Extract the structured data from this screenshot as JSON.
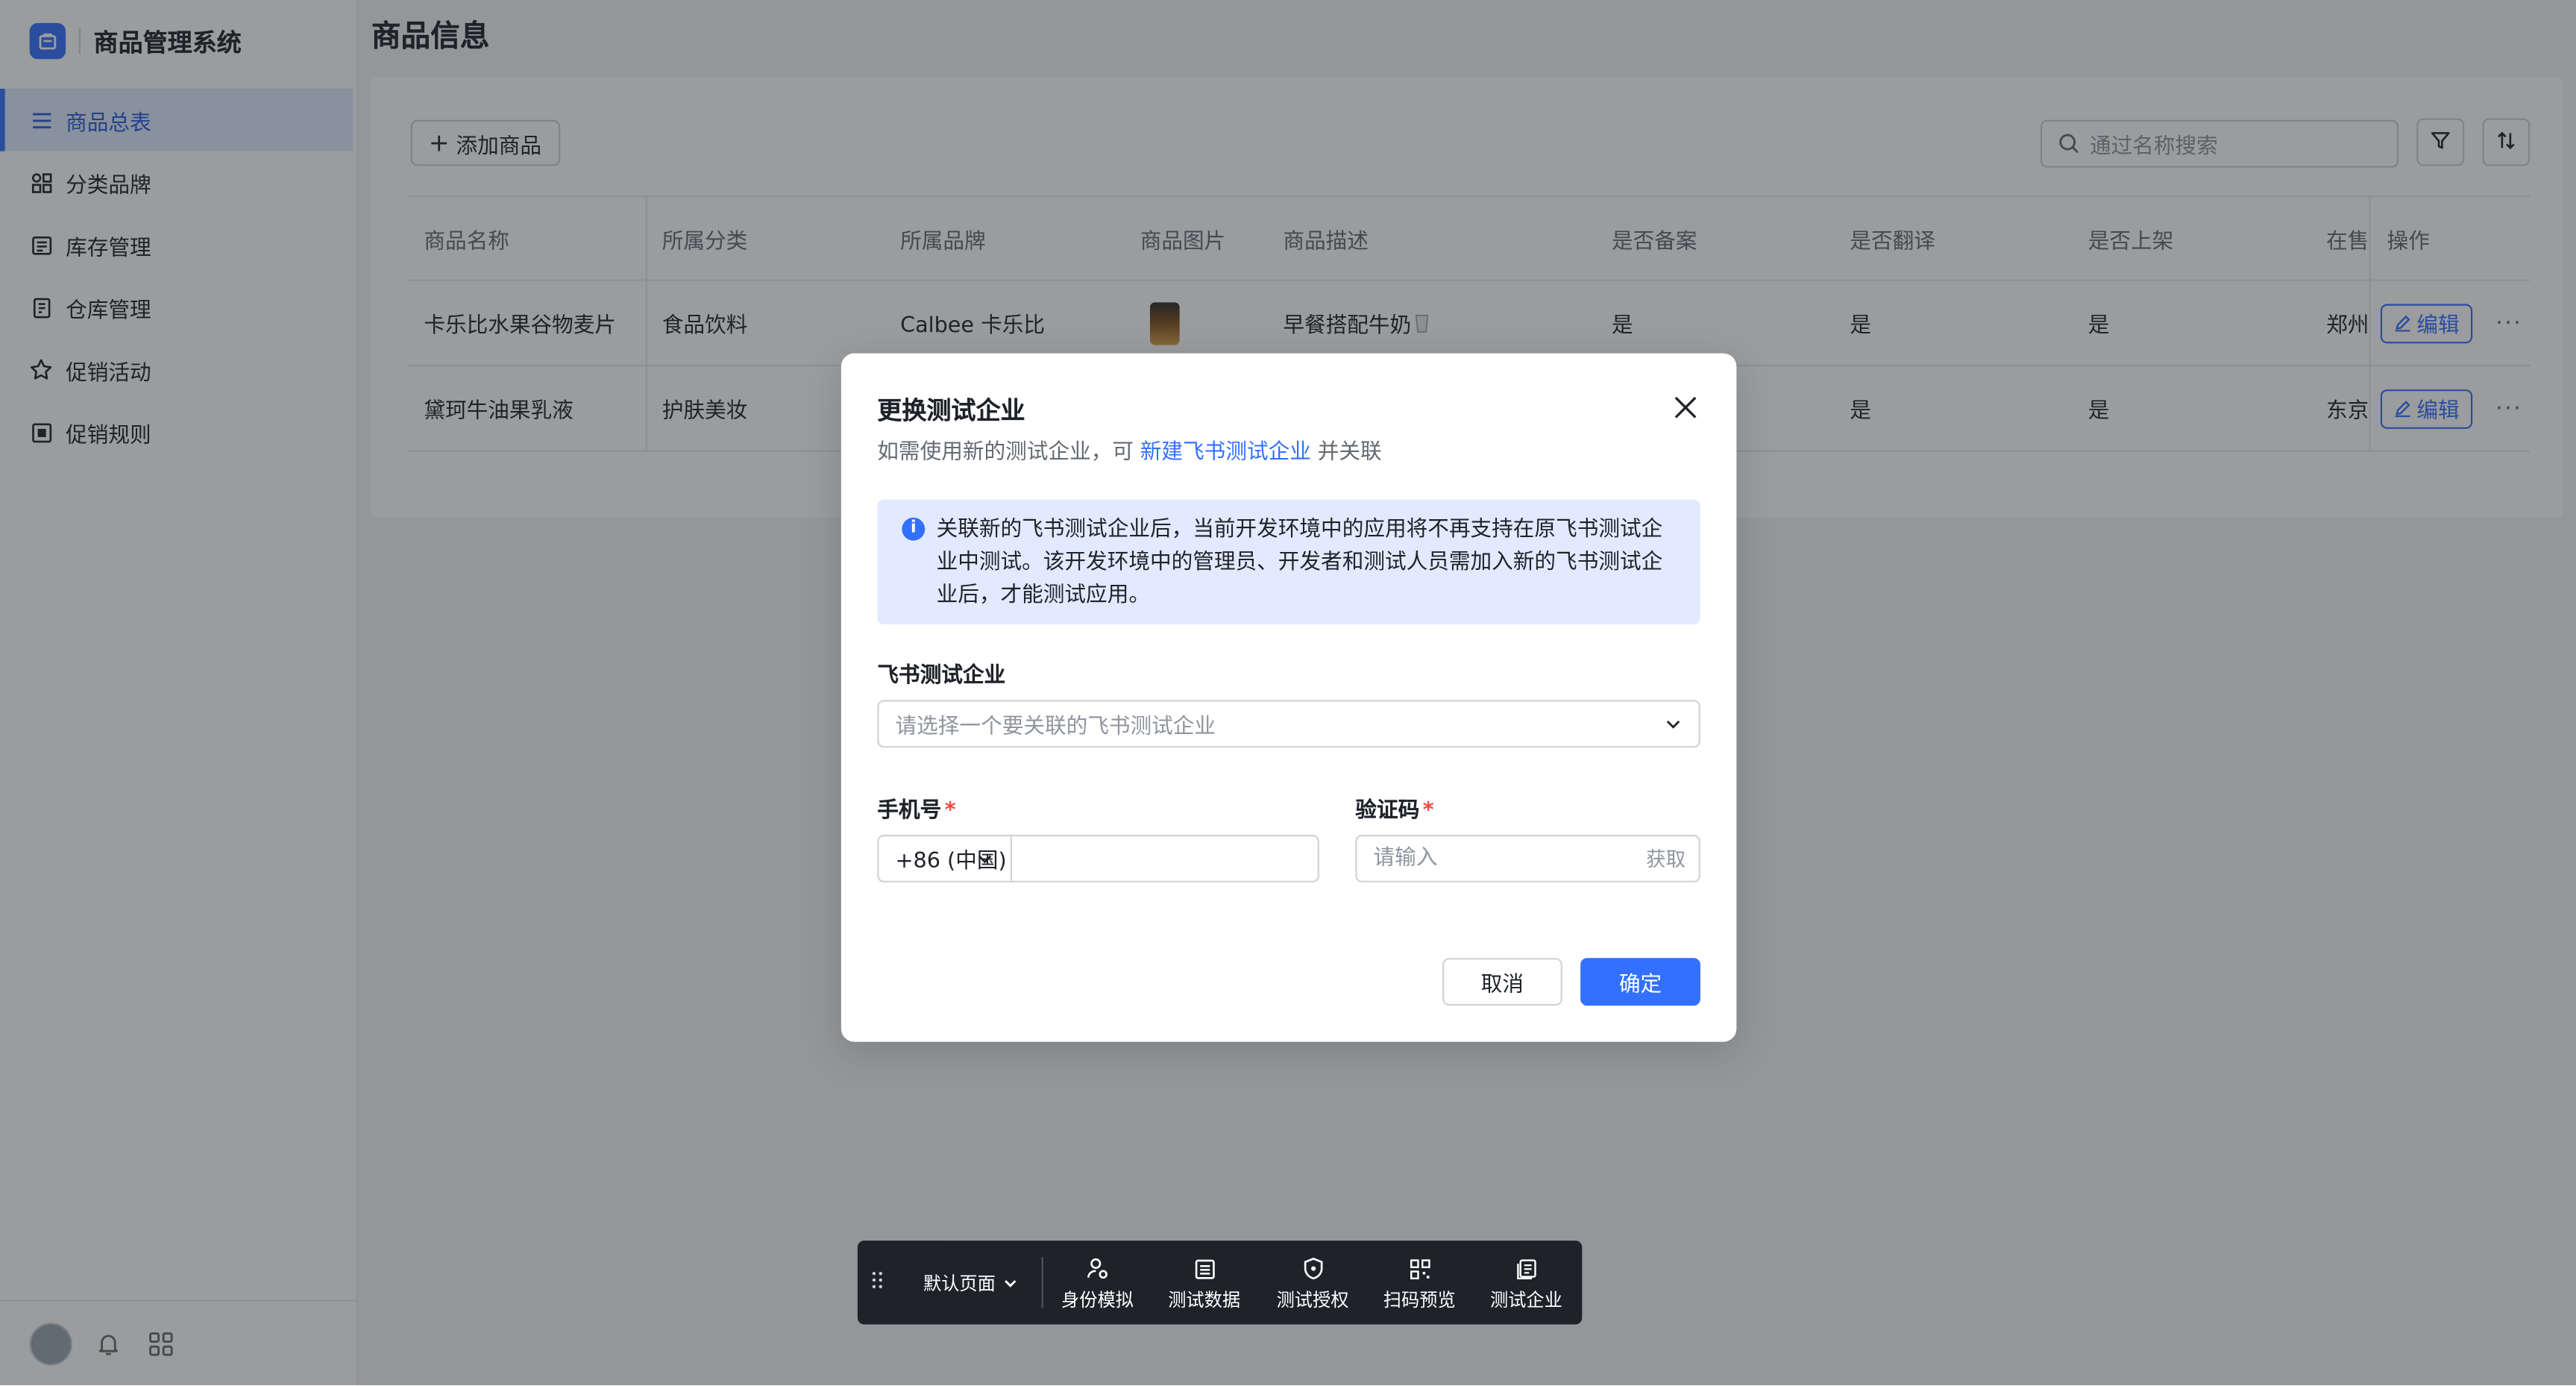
{
  "app": {
    "title": "商品管理系统"
  },
  "sidebar": {
    "items": [
      {
        "label": "商品总表",
        "icon": "list-icon",
        "active": true
      },
      {
        "label": "分类品牌",
        "icon": "grid-icon",
        "active": false
      },
      {
        "label": "库存管理",
        "icon": "inventory-icon",
        "active": false
      },
      {
        "label": "仓库管理",
        "icon": "warehouse-icon",
        "active": false
      },
      {
        "label": "促销活动",
        "icon": "star-icon",
        "active": false
      },
      {
        "label": "促销规则",
        "icon": "rule-icon",
        "active": false
      }
    ],
    "footer_icons": [
      "avatar",
      "bell-icon",
      "apps-icon"
    ]
  },
  "page": {
    "title": "商品信息",
    "add_button": "添加商品",
    "search_placeholder": "通过名称搜索"
  },
  "table": {
    "columns": [
      "商品名称",
      "所属分类",
      "所属品牌",
      "商品图片",
      "商品描述",
      "是否备案",
      "是否翻译",
      "是否上架",
      "在售",
      "操作"
    ],
    "rows": [
      {
        "name": "卡乐比水果谷物麦片",
        "category": "食品饮料",
        "brand": "Calbee 卡乐比",
        "has_image": true,
        "desc": "早餐搭配牛奶",
        "filed": "是",
        "translated": "是",
        "listed": "是",
        "onsale": "郑州",
        "edit": "编辑"
      },
      {
        "name": "黛珂牛油果乳液",
        "category": "护肤美妆",
        "brand": "",
        "has_image": false,
        "desc": "",
        "filed": "",
        "translated": "是",
        "listed": "是",
        "onsale": "东京",
        "edit": "编辑"
      }
    ]
  },
  "modal": {
    "title": "更换测试企业",
    "subtitle_prefix": "如需使用新的测试企业，可",
    "subtitle_link": "新建飞书测试企业",
    "subtitle_suffix": "并关联",
    "alert": "关联新的飞书测试企业后，当前开发环境中的应用将不再支持在原飞书测试企业中测试。该开发环境中的管理员、开发者和测试人员需加入新的飞书测试企业后，才能测试应用。",
    "tenant_label": "飞书测试企业",
    "tenant_placeholder": "请选择一个要关联的飞书测试企业",
    "phone_label": "手机号",
    "required_mark": "*",
    "country_code": "+86 (中国)",
    "phone_value": "",
    "code_label": "验证码",
    "code_placeholder": "请输入",
    "get_code": "获取",
    "cancel": "取消",
    "confirm": "确定"
  },
  "devbar": {
    "page_select": "默认页面",
    "tools": [
      {
        "label": "身份模拟",
        "icon": "user-switch-icon"
      },
      {
        "label": "测试数据",
        "icon": "data-table-icon"
      },
      {
        "label": "测试授权",
        "icon": "shield-icon"
      },
      {
        "label": "扫码预览",
        "icon": "qrcode-icon"
      },
      {
        "label": "测试企业",
        "icon": "enterprise-icon"
      }
    ]
  },
  "colors": {
    "primary": "#3370ff",
    "active_bg": "#e1eaff",
    "required": "#f54a45",
    "devbar_bg": "#1f2329"
  }
}
